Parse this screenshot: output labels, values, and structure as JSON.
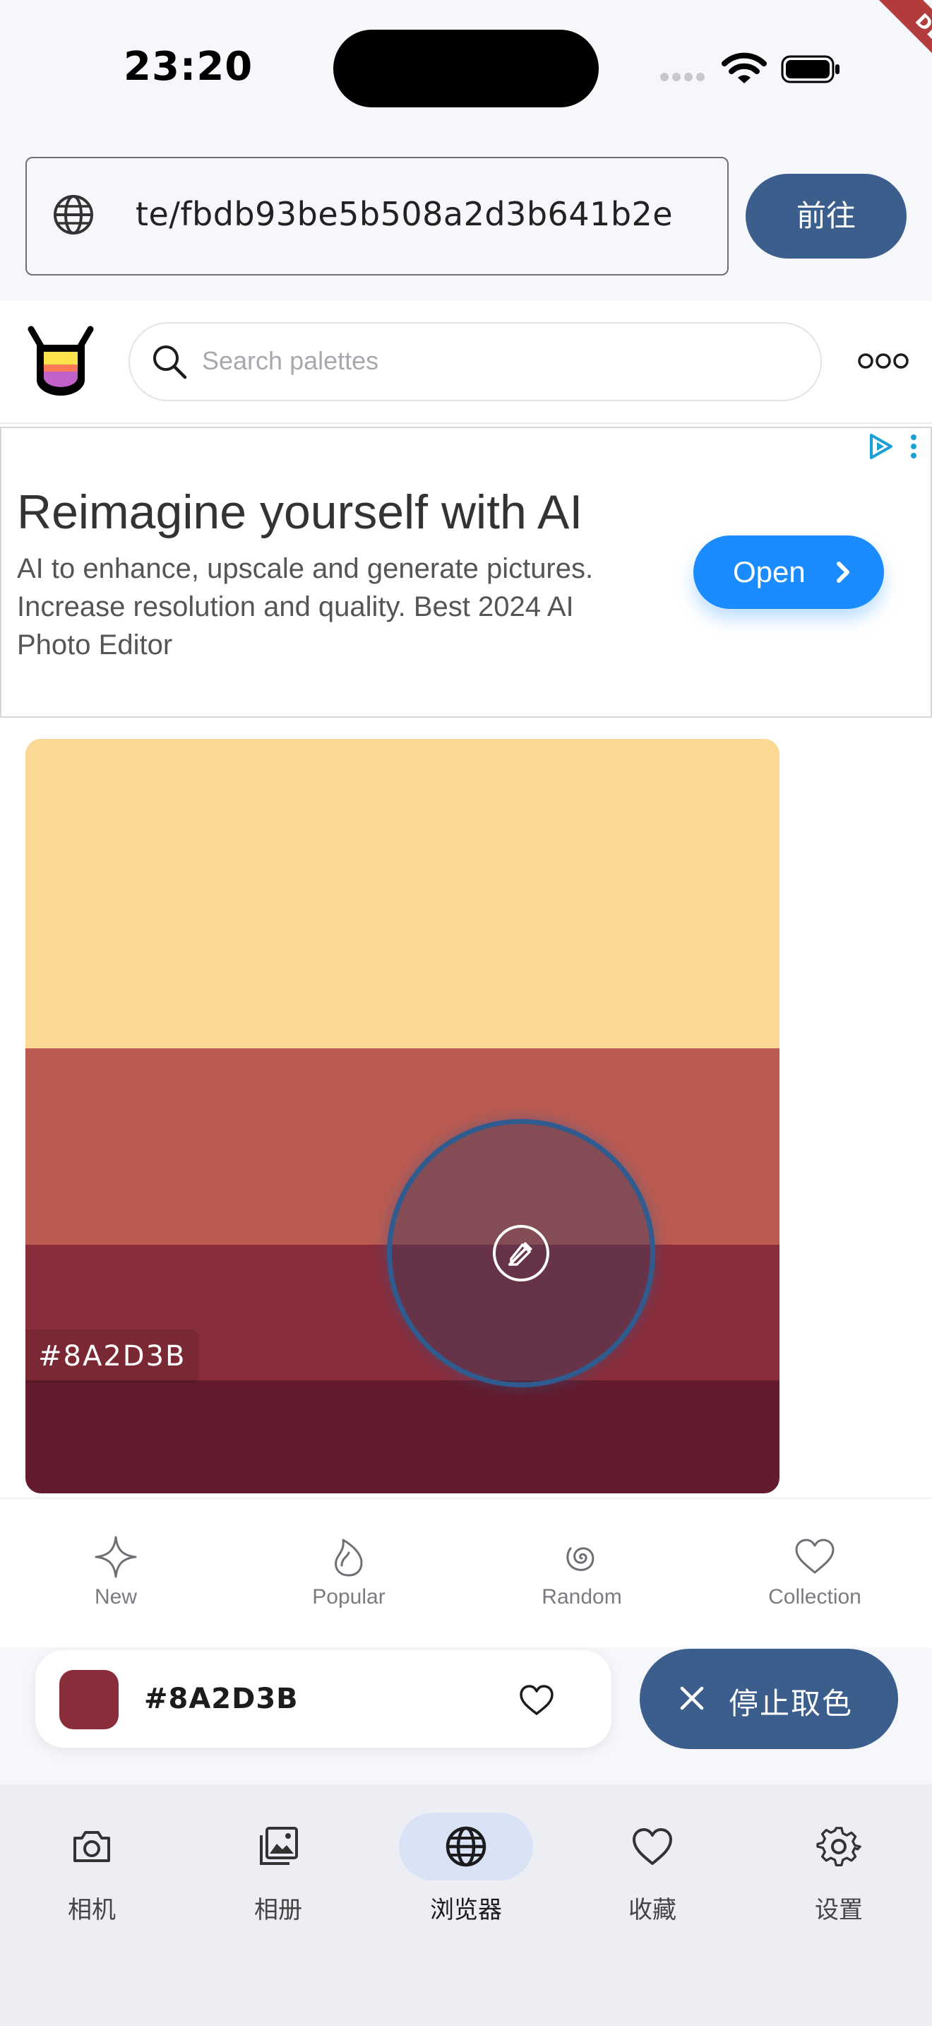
{
  "status_bar": {
    "time": "23:20",
    "debug_label": "DEBUG"
  },
  "url_bar": {
    "url": "te/fbdb93be5b508a2d3b641b2e",
    "go_label": "前往"
  },
  "site_header": {
    "search_placeholder": "Search palettes"
  },
  "ad": {
    "title": "Reimagine yourself with AI",
    "body": "AI to enhance, upscale and generate pictures. Increase resolution and quality. Best 2024 AI Photo Editor",
    "cta": "Open"
  },
  "palette": {
    "colors": [
      "#fbd893",
      "#bc5b51",
      "#8a2d3b",
      "#631b2d"
    ],
    "hovered_hex": "#8A2D3B"
  },
  "site_tabs": [
    {
      "label": "New",
      "icon": "sparkle-icon"
    },
    {
      "label": "Popular",
      "icon": "flame-icon"
    },
    {
      "label": "Random",
      "icon": "spiral-icon"
    },
    {
      "label": "Collection",
      "icon": "heart-icon"
    }
  ],
  "picker": {
    "hex": "#8A2D3B",
    "swatch_color": "#8a2d3b",
    "stop_label": "停止取色"
  },
  "bottom_nav": {
    "active_index": 2,
    "items": [
      {
        "label": "相机",
        "icon": "camera-icon"
      },
      {
        "label": "相册",
        "icon": "gallery-icon"
      },
      {
        "label": "浏览器",
        "icon": "globe-icon"
      },
      {
        "label": "收藏",
        "icon": "heart-icon"
      },
      {
        "label": "设置",
        "icon": "gear-icon"
      }
    ]
  },
  "colors": {
    "accent": "#3c5e8c",
    "ad_button": "#1a8cff",
    "nav_active_pill": "#d9e3f5"
  }
}
